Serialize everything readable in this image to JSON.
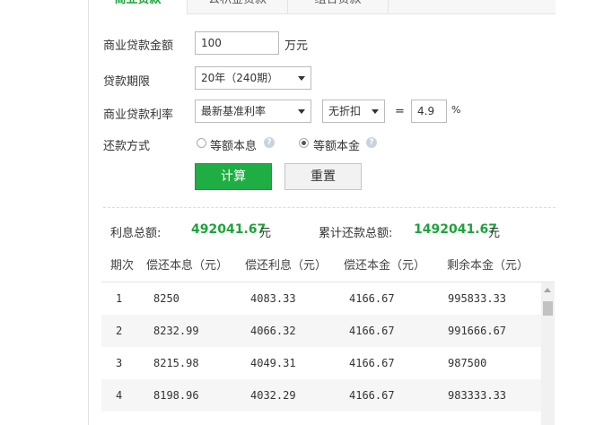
{
  "tabs": [
    {
      "label": "商业贷款"
    },
    {
      "label": "公积金贷款"
    },
    {
      "label": "组合贷款"
    }
  ],
  "form": {
    "amount_label": "商业贷款金额",
    "amount_value": "100",
    "amount_unit": "万元",
    "term_label": "贷款期限",
    "term_value": "20年（240期）",
    "rate_label": "商业贷款利率",
    "rate_type_value": "最新基准利率",
    "discount_value": "无折扣",
    "equals": "=",
    "rate_value": "4.9",
    "rate_unit": "%",
    "method_label": "还款方式",
    "method_options": [
      {
        "label": "等额本息",
        "selected": false
      },
      {
        "label": "等额本金",
        "selected": true
      }
    ],
    "help_icon": "?"
  },
  "buttons": {
    "calc": "计算",
    "reset": "重置"
  },
  "summary": {
    "interest_label": "利息总额:",
    "interest_value": "492041.67",
    "interest_unit": "元",
    "total_label": "累计还款总额:",
    "total_value": "1492041.67",
    "total_unit": "元"
  },
  "table": {
    "headers": [
      "期次",
      "偿还本息（元）",
      "偿还利息（元）",
      "偿还本金（元）",
      "剩余本金（元）"
    ],
    "rows": [
      [
        "1",
        "8250",
        "4083.33",
        "4166.67",
        "995833.33"
      ],
      [
        "2",
        "8232.99",
        "4066.32",
        "4166.67",
        "991666.67"
      ],
      [
        "3",
        "8215.98",
        "4049.31",
        "4166.67",
        "987500"
      ],
      [
        "4",
        "8198.96",
        "4032.29",
        "4166.67",
        "983333.33"
      ]
    ]
  },
  "colors": {
    "accent_green": "#1fae44",
    "value_green": "#1da43b"
  }
}
